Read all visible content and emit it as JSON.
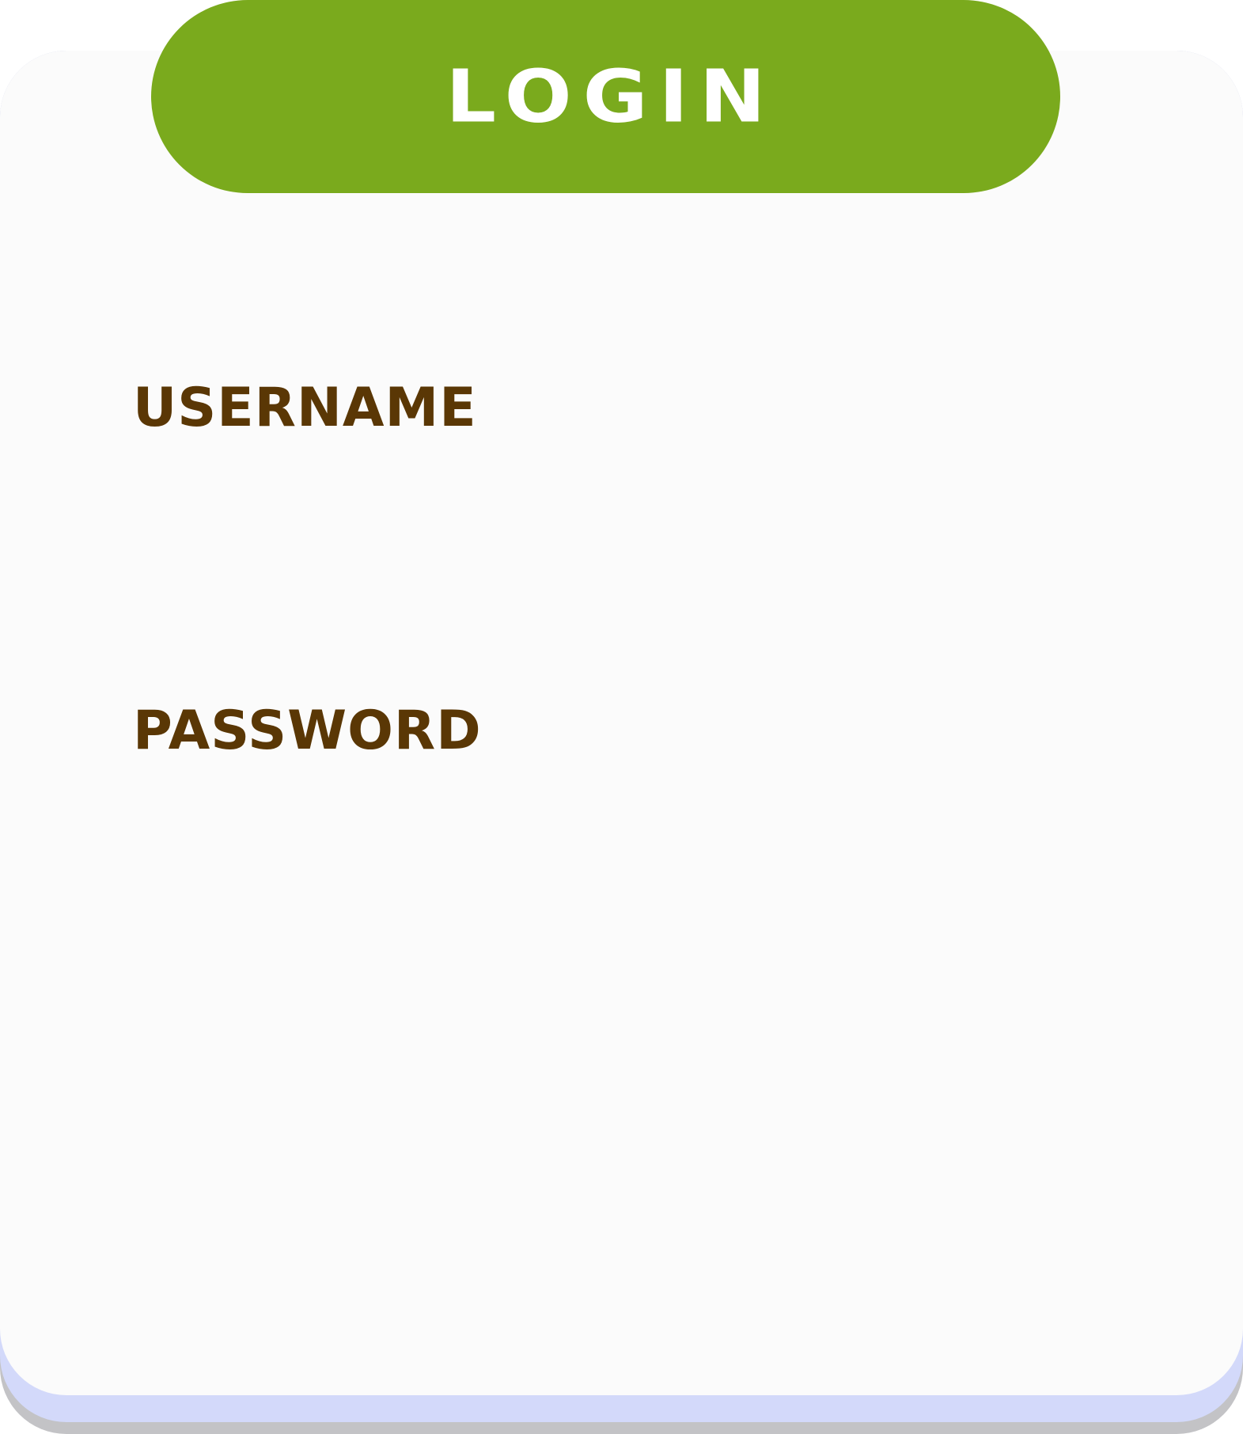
{
  "header": {
    "title": "LOGIN"
  },
  "form": {
    "username": {
      "label": "USERNAME",
      "value": "",
      "placeholder": ""
    },
    "password": {
      "label": "PASSWORD",
      "value": "",
      "placeholder": ""
    }
  },
  "colors": {
    "title_bar": "#7aaa1d",
    "label_text": "#5a3705",
    "card_background": "#fbfbfb",
    "card_underlay": "#d3d9fa",
    "card_shadow": "#c3c3c6"
  }
}
